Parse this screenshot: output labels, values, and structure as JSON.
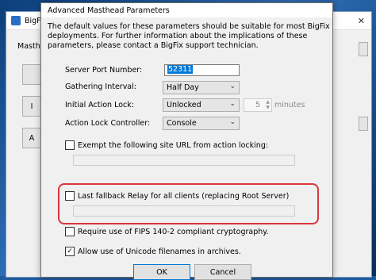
{
  "background_window": {
    "title": "BigFix",
    "panel_label": "Masthead",
    "button_labels": [
      "",
      "I",
      "A"
    ]
  },
  "dialog": {
    "title": "Advanced Masthead Parameters",
    "intro": "The default values for these parameters should be suitable for most BigFix deployments.  For further information about the implications of these parameters, please contact a BigFix support technician.",
    "server_port": {
      "label": "Server Port Number:",
      "value": "52311"
    },
    "gathering_interval": {
      "label": "Gathering Interval:",
      "value": "Half Day"
    },
    "initial_action_lock": {
      "label": "Initial Action Lock:",
      "value": "Unlocked",
      "minutes_value": "5",
      "minutes_unit": "minutes"
    },
    "action_lock_controller": {
      "label": "Action Lock Controller:",
      "value": "Console"
    },
    "exempt_url": {
      "label": "Exempt the following site URL from action locking:",
      "checked": false,
      "value": ""
    },
    "last_fallback_relay": {
      "label": "Last fallback Relay for all clients (replacing Root Server)",
      "checked": false,
      "value": ""
    },
    "fips": {
      "label": "Require use of FIPS 140-2 compliant cryptography.",
      "checked": false
    },
    "unicode": {
      "label": "Allow use of Unicode filenames in archives.",
      "checked": true
    },
    "ok_label": "OK",
    "cancel_label": "Cancel"
  },
  "colors": {
    "highlight": "#d9363e",
    "selection": "#0078d7",
    "dialog_bg": "#f0f0f0"
  }
}
